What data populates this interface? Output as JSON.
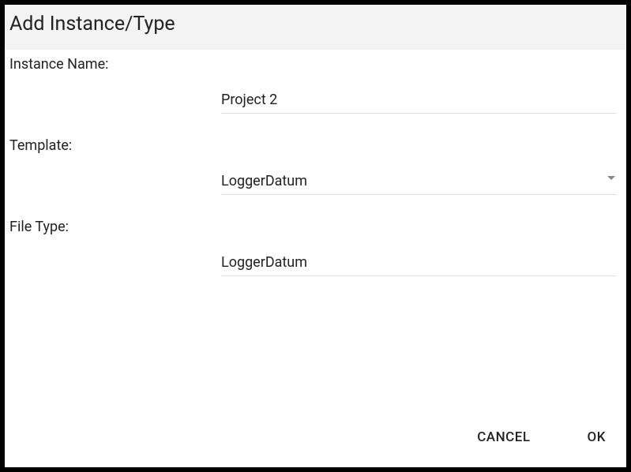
{
  "dialog": {
    "title": "Add Instance/Type"
  },
  "fields": {
    "instanceName": {
      "label": "Instance Name:",
      "value": "Project 2"
    },
    "template": {
      "label": "Template:",
      "value": "LoggerDatum"
    },
    "fileType": {
      "label": "File Type:",
      "value": "LoggerDatum"
    }
  },
  "actions": {
    "cancel": "CANCEL",
    "ok": "OK"
  }
}
